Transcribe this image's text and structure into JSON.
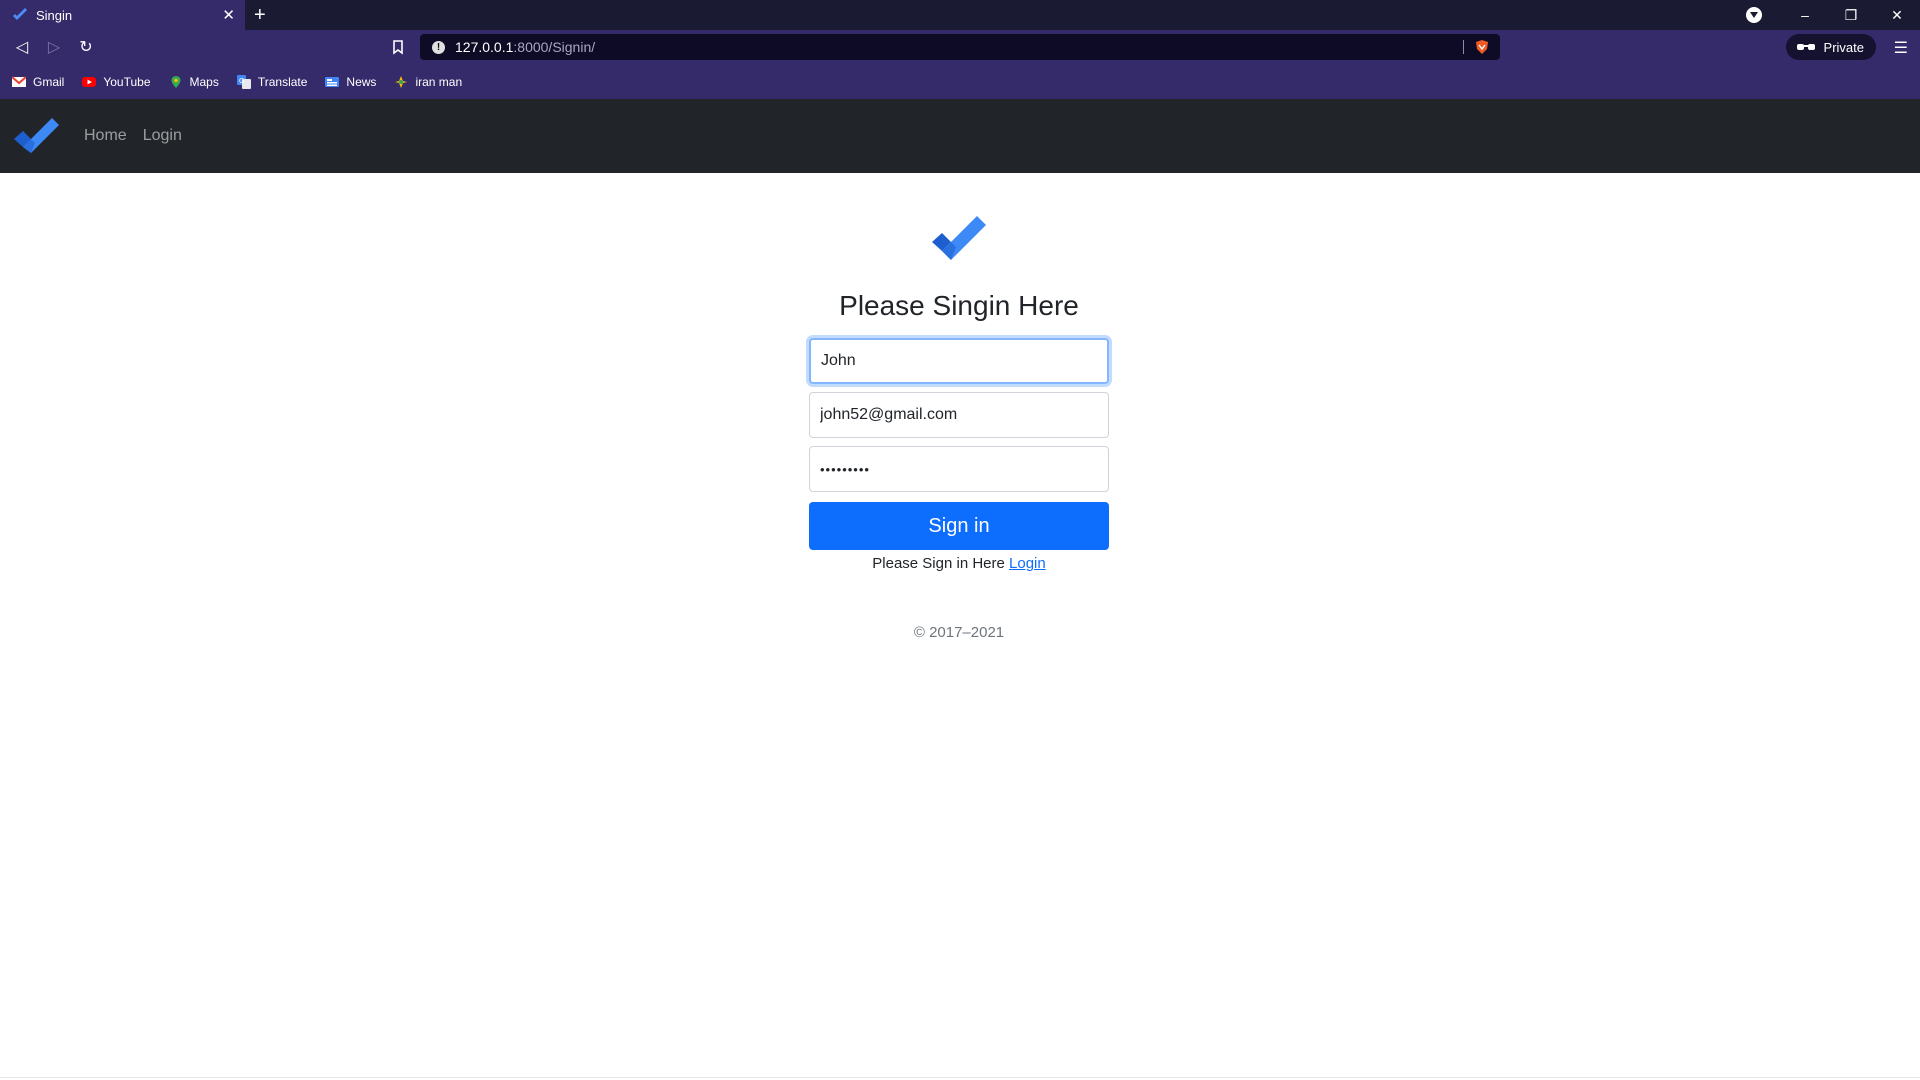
{
  "browser": {
    "tab_title": "Singin",
    "url_host": "127.0.0.1",
    "url_path": ":8000/Signin/",
    "private_label": "Private",
    "bookmarks": [
      {
        "label": "Gmail",
        "icon": "gmail-icon"
      },
      {
        "label": "YouTube",
        "icon": "youtube-icon"
      },
      {
        "label": "Maps",
        "icon": "maps-icon"
      },
      {
        "label": "Translate",
        "icon": "translate-icon"
      },
      {
        "label": "News",
        "icon": "news-icon"
      },
      {
        "label": "iran man",
        "icon": "bookmark-favicon-icon"
      }
    ]
  },
  "navbar": {
    "links": [
      {
        "label": "Home"
      },
      {
        "label": "Login"
      }
    ]
  },
  "form": {
    "heading": "Please Singin Here",
    "username_value": "John",
    "email_value": "john52@gmail.com",
    "password_value": "•••••••••",
    "submit_label": "Sign in",
    "helper_text": "Please Sign in Here",
    "helper_link": "Login"
  },
  "footer": {
    "copyright": "© 2017–2021"
  },
  "colors": {
    "primary": "#0d6efd",
    "navbar_bg": "#212529",
    "browser_bg": "#352a6a"
  }
}
